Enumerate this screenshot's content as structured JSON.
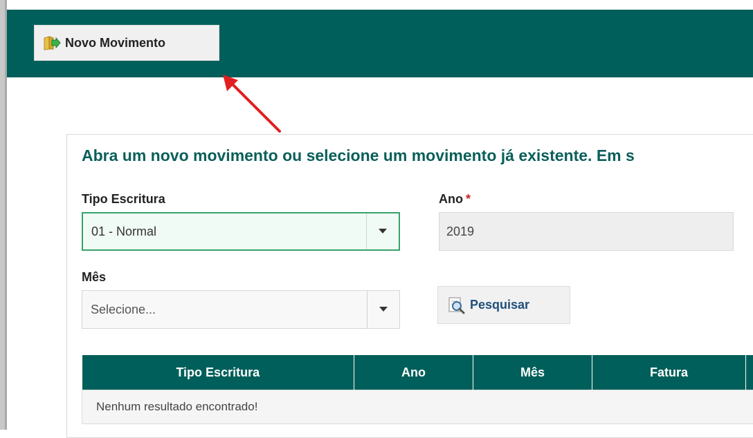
{
  "toolbar": {
    "new_movement_label": "Novo Movimento",
    "new_movement_icon": "folder-arrow-icon"
  },
  "panel": {
    "title": "Abra um novo movimento ou selecione um movimento já existente. Em s"
  },
  "form": {
    "tipo_escritura": {
      "label": "Tipo Escritura",
      "value": "01 - Normal"
    },
    "ano": {
      "label": "Ano",
      "required_mark": "*",
      "value": "2019"
    },
    "mes": {
      "label": "Mês",
      "value": "Selecione..."
    },
    "search_button_label": "Pesquisar",
    "search_button_icon": "magnifier-page-icon"
  },
  "table": {
    "headers": [
      "Tipo Escritura",
      "Ano",
      "Mês",
      "Fatura",
      ""
    ],
    "empty_message": "Nenhum resultado encontrado!"
  },
  "colors": {
    "brand": "#005f5a",
    "arrow": "#e02020",
    "focus": "#34a36b"
  }
}
